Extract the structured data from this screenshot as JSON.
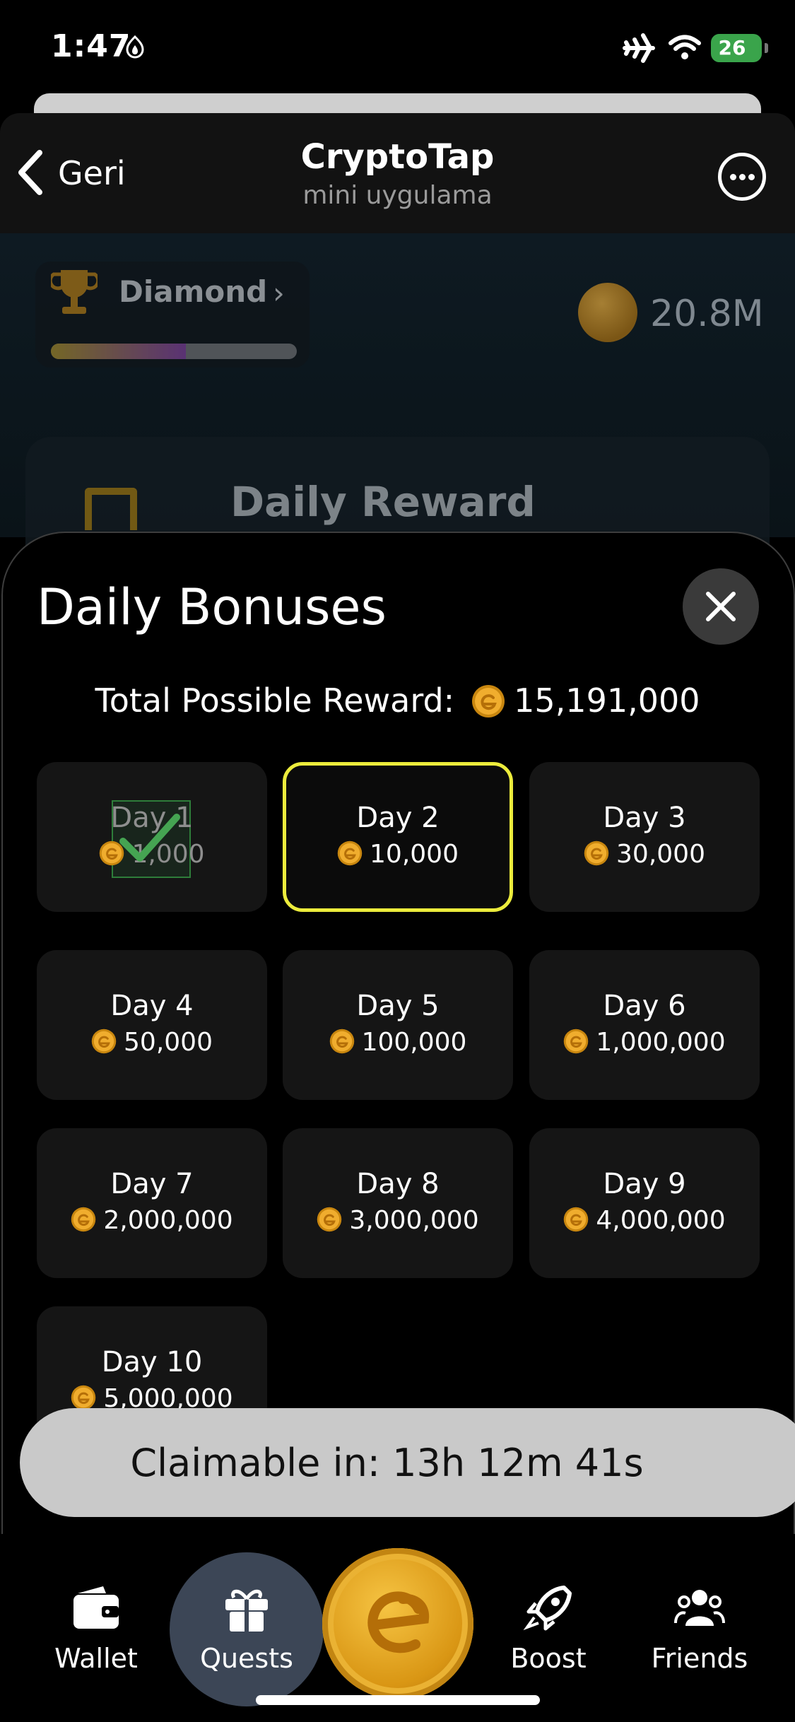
{
  "status_bar": {
    "time": "1:47",
    "battery": "26"
  },
  "header": {
    "back_label": "Geri",
    "title": "CryptoTap",
    "subtitle": "mini uygulama"
  },
  "background": {
    "league": "Diamond",
    "league_progress": 0.55,
    "balance": "20.8M",
    "daily_reward_label": "Daily Reward"
  },
  "sheet": {
    "title": "Daily Bonuses",
    "total_label": "Total Possible Reward:",
    "total_value": "15,191,000",
    "days": [
      {
        "label": "Day 1",
        "reward": "1,000",
        "state": "claimed"
      },
      {
        "label": "Day 2",
        "reward": "10,000",
        "state": "current"
      },
      {
        "label": "Day 3",
        "reward": "30,000",
        "state": "locked"
      },
      {
        "label": "Day 4",
        "reward": "50,000",
        "state": "locked"
      },
      {
        "label": "Day 5",
        "reward": "100,000",
        "state": "locked"
      },
      {
        "label": "Day 6",
        "reward": "1,000,000",
        "state": "locked"
      },
      {
        "label": "Day 7",
        "reward": "2,000,000",
        "state": "locked"
      },
      {
        "label": "Day 8",
        "reward": "3,000,000",
        "state": "locked"
      },
      {
        "label": "Day 9",
        "reward": "4,000,000",
        "state": "locked"
      },
      {
        "label": "Day 10",
        "reward": "5,000,000",
        "state": "locked"
      }
    ],
    "claim_label": "Claimable in: 13h 12m 41s"
  },
  "tabs": [
    {
      "label": "Wallet",
      "icon": "wallet-icon"
    },
    {
      "label": "Quests",
      "icon": "gift-icon",
      "active": true
    },
    {
      "label": "Boost",
      "icon": "rocket-icon"
    },
    {
      "label": "Friends",
      "icon": "friends-icon"
    }
  ],
  "colors": {
    "accent": "#ecec3c",
    "coin": "#e2a12a",
    "claimed_check": "#4caf50",
    "active_tab": "#3c4656"
  }
}
